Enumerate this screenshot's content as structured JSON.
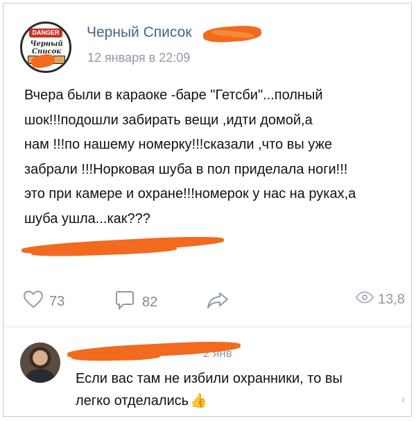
{
  "post": {
    "author": "Черный Список",
    "avatar": {
      "badge_text": "DANGER",
      "logo_text": "Черный Список"
    },
    "time": "12 января в 22:09",
    "body_lines": [
      "Вчера были в караоке -баре \"Гетсби\"...полный",
      "шок!!!подошли забирать вещи ,идти домой,а",
      "нам !!!по нашему номерку!!!сказали ,что вы уже",
      "забрали !!!Норковая шуба в пол приделала ноги!!!",
      "это при камере и охране!!!номерок у нас на руках,а",
      "шуба ушла...как???"
    ],
    "likes": "73",
    "comments": "82",
    "views": "13,8"
  },
  "comment": {
    "date": "2 янв",
    "text_lines": [
      "Если вас там не избили охранники, то вы",
      "легко отделались"
    ],
    "emoji": "👍"
  },
  "icons": {
    "like": "heart-icon",
    "comment": "comment-bubble-icon",
    "share": "share-arrow-icon",
    "views": "eye-icon",
    "reply": "chevron-icon"
  },
  "colors": {
    "author_link": "#41648b",
    "meta_gray": "#8e9aa7",
    "censor_orange": "#f26a1d"
  }
}
